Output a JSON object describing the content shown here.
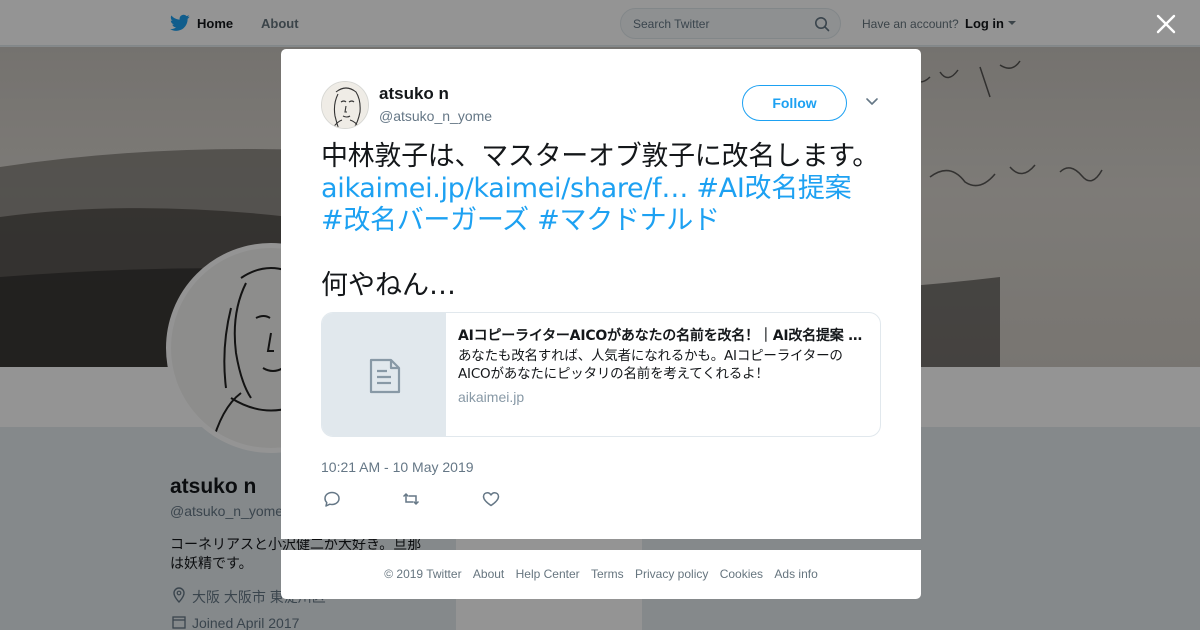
{
  "nav": {
    "home_label": "Home",
    "about_label": "About",
    "search_placeholder": "Search Twitter",
    "account_prompt": "Have an account?",
    "login_label": "Log in"
  },
  "profile": {
    "name": "atsuko n",
    "handle": "@atsuko_n_yome",
    "bio": "コーネリアスと小沢健二が大好き。旦那は妖精です。",
    "location": "大阪 大阪市 東淀川区",
    "joined": "Joined April 2017"
  },
  "tweet": {
    "author_name": "atsuko n",
    "author_handle": "@atsuko_n_yome",
    "follow_label": "Follow",
    "text_part1": "中林敦子は、マスターオブ敦子に改名します。",
    "link": "aikaimei.jp/kaimei/share/f…",
    "hashtag1": "#AI改名提案",
    "hashtag2": "#改名バーガーズ",
    "hashtag3": "#マクドナルド",
    "text_part2": "何やねん…",
    "card": {
      "title": "AIコピーライターAICOがあなたの名前を改名！｜AI改名提案 …",
      "description": "あなたも改名すれば、人気者になれるかも。AIコピーライターのAICOがあなたにピッタリの名前を考えてくれるよ！",
      "domain": "aikaimei.jp"
    },
    "timestamp": "10:21 AM - 10 May 2019"
  },
  "footer": {
    "copyright": "© 2019 Twitter",
    "about": "About",
    "help_center": "Help Center",
    "terms": "Terms",
    "privacy": "Privacy policy",
    "cookies": "Cookies",
    "ads_info": "Ads info"
  },
  "colors": {
    "accent": "#1da1f2",
    "secondary_text": "#657786",
    "overlay": "rgba(0,0,0,0.42)"
  },
  "icons": {
    "logo": "twitter-bird-icon",
    "search": "search-icon",
    "close": "close-icon",
    "chevron": "chevron-down-icon",
    "reply": "reply-icon",
    "retweet": "retweet-icon",
    "like": "heart-icon",
    "card": "document-icon",
    "location": "location-pin-icon",
    "calendar": "calendar-icon"
  }
}
